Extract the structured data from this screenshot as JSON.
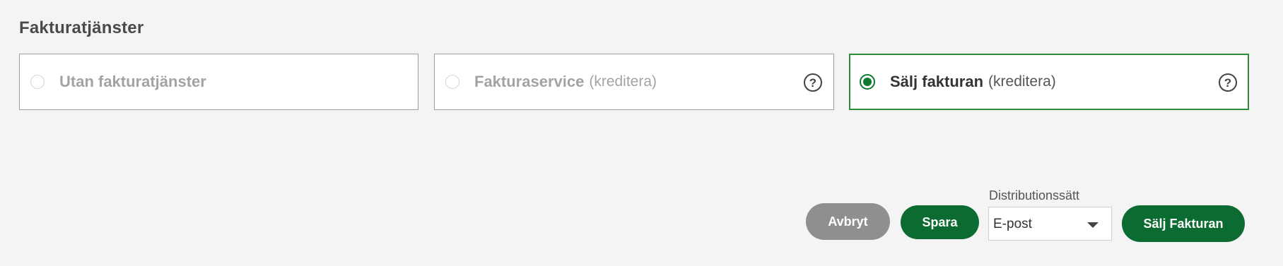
{
  "section": {
    "title": "Fakturatjänster"
  },
  "options": [
    {
      "label": "Utan fakturatjänster",
      "sub": "",
      "selected": false,
      "help": false
    },
    {
      "label": "Fakturaservice",
      "sub": "(kreditera)",
      "selected": false,
      "help": true,
      "help_icon": "question-circle-icon",
      "help_glyph": "?"
    },
    {
      "label": "Sälj fakturan",
      "sub": "(kreditera)",
      "selected": true,
      "help": true,
      "help_icon": "question-circle-icon",
      "help_glyph": "?"
    }
  ],
  "actions": {
    "cancel_label": "Avbryt",
    "save_label": "Spara",
    "sell_label": "Sälj Fakturan"
  },
  "distribution": {
    "label": "Distributionssätt",
    "value": "E-post"
  },
  "colors": {
    "primary_green": "#0c6b31",
    "selected_border": "#2e8b3a",
    "cancel_gray": "#8f8f8f",
    "background": "#f4f4f4"
  }
}
